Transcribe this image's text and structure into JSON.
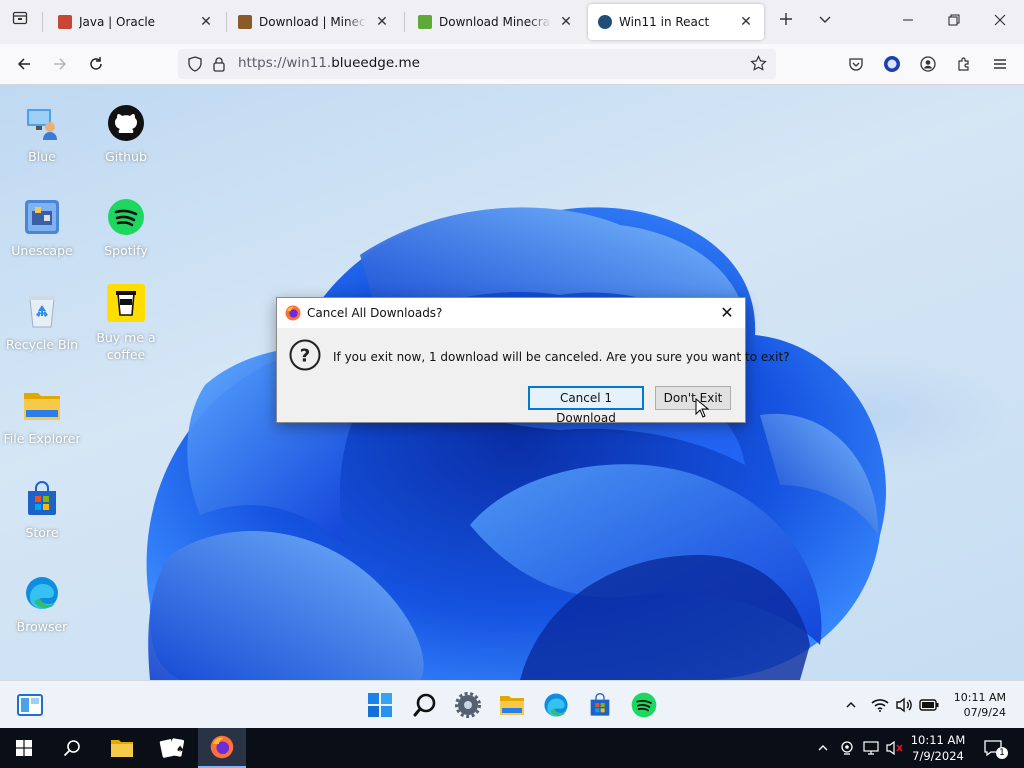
{
  "browser": {
    "tabs": [
      {
        "title": "Java | Oracle",
        "favicon_color": "#c74634",
        "active": false
      },
      {
        "title": "Download | Minecraft",
        "favicon_color": "#8b5a2b",
        "active": false
      },
      {
        "title": "Download Minecraft &",
        "favicon_color": "#5fa83a",
        "active": false
      },
      {
        "title": "Win11 in React",
        "favicon_color": "#1f4e79",
        "active": true
      }
    ],
    "new_tab_icon": "plus-icon",
    "list_tabs_icon": "chevron-down-icon",
    "url_prefix": "https://win11.",
    "url_domain": "blueedge.me"
  },
  "desktop": {
    "icons": [
      {
        "label": "Blue",
        "icon": "blue-user-icon"
      },
      {
        "label": "Github",
        "icon": "github-icon"
      },
      {
        "label": "Unescape",
        "icon": "unescape-icon"
      },
      {
        "label": "Spotify",
        "icon": "spotify-icon"
      },
      {
        "label": "Recycle Bin",
        "icon": "recycle-bin-icon"
      },
      {
        "label": "Buy me a coffee",
        "icon": "coffee-icon"
      },
      {
        "label": "File Explorer",
        "icon": "folder-icon"
      },
      {
        "label": "Store",
        "icon": "store-icon"
      },
      {
        "label": "Browser",
        "icon": "edge-icon"
      }
    ]
  },
  "dialog": {
    "title": "Cancel All Downloads?",
    "message": "If you exit now, 1 download will be canceled. Are you sure you want to exit?",
    "cancel_button": "Cancel 1 Download",
    "stay_button": "Don't Exit"
  },
  "win11_taskbar": {
    "time": "10:11 AM",
    "date": "07/9/24",
    "apps": [
      "start-icon",
      "search-icon",
      "settings-icon",
      "file-explorer-icon",
      "edge-icon",
      "store-icon",
      "spotify-icon"
    ]
  },
  "host_taskbar": {
    "time": "10:11 AM",
    "date": "7/9/2024",
    "notification_count": "1"
  },
  "colors": {
    "accent": "#0078d7",
    "spotify": "#1ed760",
    "firefox": "#ff7139"
  }
}
